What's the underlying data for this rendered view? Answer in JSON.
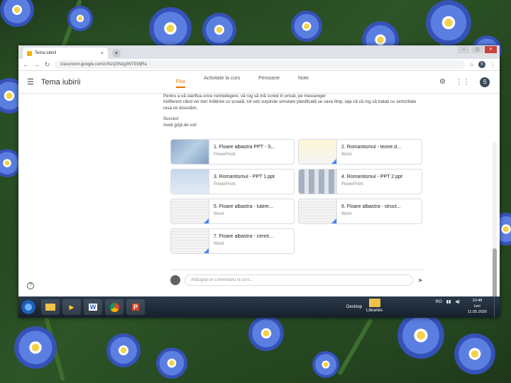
{
  "browser": {
    "tab_title": "Tema iubirii",
    "tab_close": "×",
    "new_tab": "+",
    "url": "classroom.google.com/c/NzQ0Nzg3NTEMjRa",
    "profile_initial": "S",
    "window_controls": [
      "–",
      "▢",
      "✕"
    ]
  },
  "app": {
    "class_title": "Tema iubirii",
    "tabs": [
      "Flux",
      "Activitate la curs",
      "Persoane",
      "Note"
    ],
    "active_tab": "Flux",
    "profile_initial": "S"
  },
  "post": {
    "lines": [
      "Pentru a vă clarifica orice neînțelegere, vă rog să mă scrieți în privat, pe messenger",
      "Indiferent când vei dori întâlnire cu școală, tot veți surpinde simulare planificată se cava timp, iaja că vă rog să tratați cu seriozitate rasa ce discutăm."
    ],
    "sign_1": "Succes!",
    "sign_2": "Aveți grijă de voi!"
  },
  "attachments": [
    {
      "title": "1. Floare albastra PPT - S...",
      "type": "PowerPoint"
    },
    {
      "title": "2. Romantismul - teorie.d...",
      "type": "Word"
    },
    {
      "title": "3. Romantismul - PPT 1.ppt",
      "type": "PowerPoint"
    },
    {
      "title": "4. Romantismul - PPT 2.ppt",
      "type": "PowerPoint"
    },
    {
      "title": "5. Floare albastra - lubire...",
      "type": "Word"
    },
    {
      "title": "6. Floare albastra - struct...",
      "type": "Word"
    },
    {
      "title": "7. Floare albastra - cerint...",
      "type": "Word"
    }
  ],
  "comment": {
    "placeholder": "Adăugați un comentariu la curs..."
  },
  "taskbar": {
    "desktop_label": "Desktop",
    "libraries_label": "Libraries",
    "tray_lang": "RO",
    "time": "10:48",
    "day": "luni",
    "date": "11.05.2020"
  }
}
